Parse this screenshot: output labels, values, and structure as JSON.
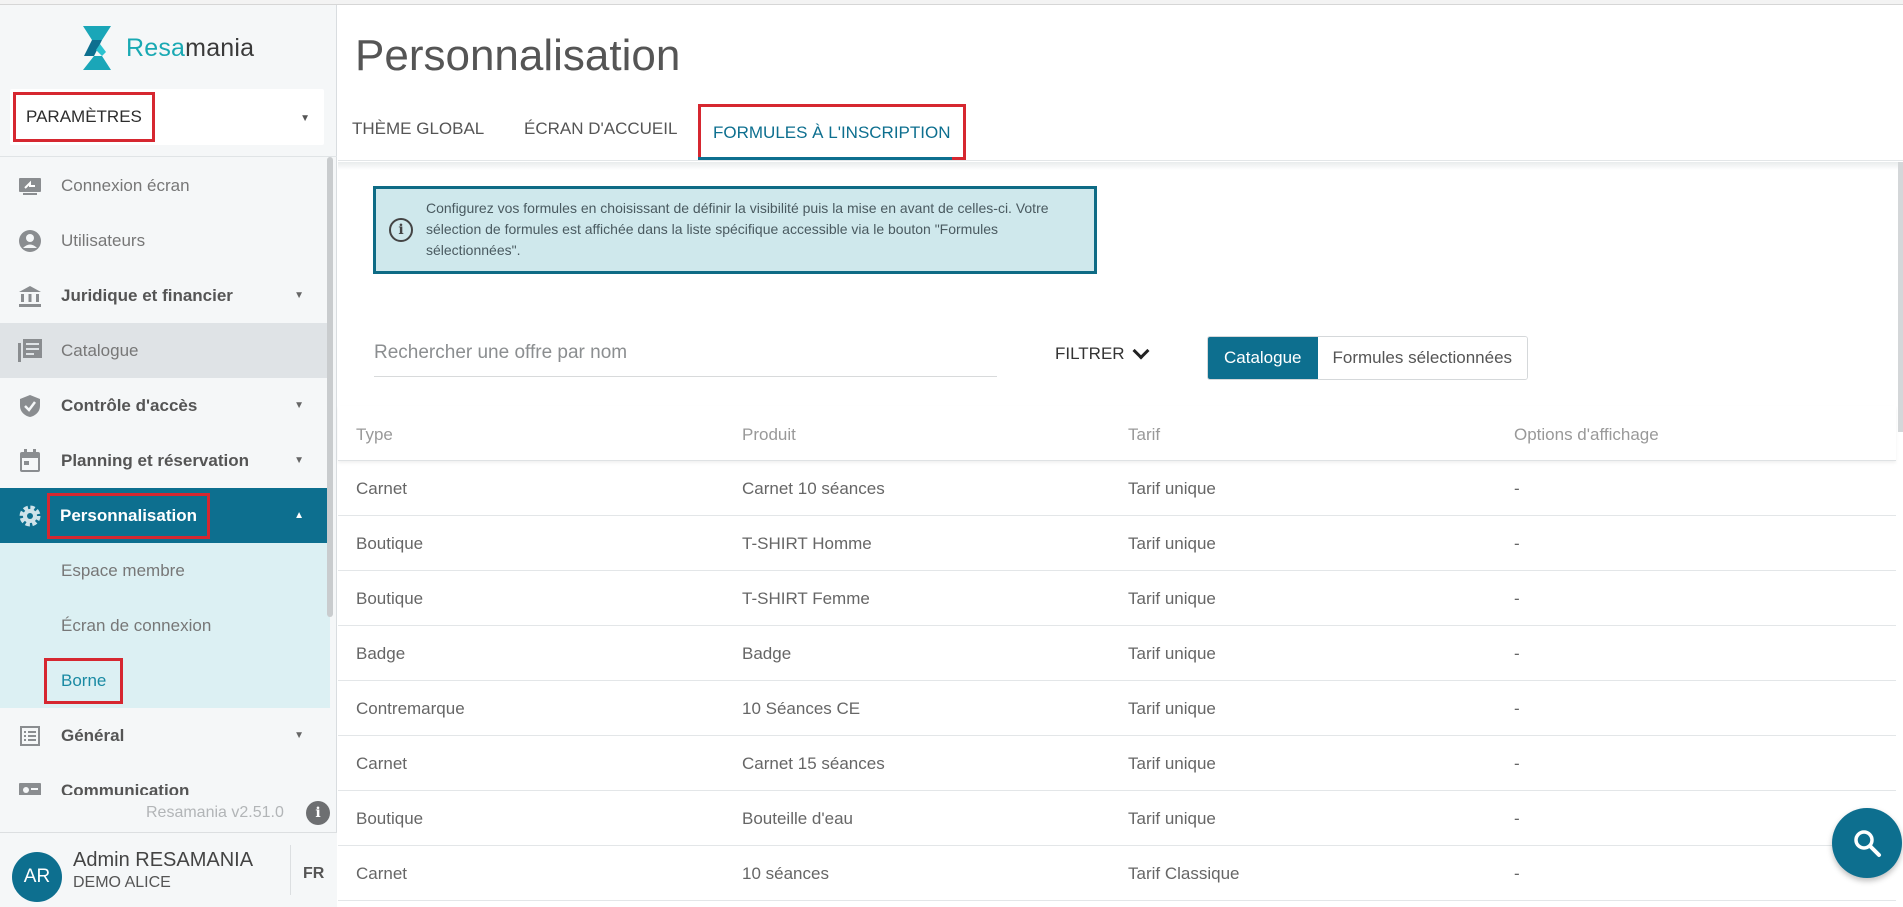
{
  "brand": {
    "part1": "Resa",
    "part2": "mania"
  },
  "module": {
    "label": "PARAMÈTRES"
  },
  "sidebar": {
    "items": [
      {
        "label": "Connexion écran",
        "icon": "screen-share-icon"
      },
      {
        "label": "Utilisateurs",
        "icon": "user-circle-icon"
      },
      {
        "label": "Juridique et financier",
        "icon": "bank-icon"
      },
      {
        "label": "Catalogue",
        "icon": "catalogue-icon"
      },
      {
        "label": "Contrôle d'accès",
        "icon": "shield-check-icon"
      },
      {
        "label": "Planning et réservation",
        "icon": "calendar-icon"
      },
      {
        "label": "Personnalisation",
        "icon": "gear-icon"
      },
      {
        "label": "Espace membre"
      },
      {
        "label": "Écran de connexion"
      },
      {
        "label": "Borne"
      },
      {
        "label": "Général",
        "icon": "list-icon"
      },
      {
        "label": "Communication",
        "icon": "contact-card-icon"
      }
    ],
    "version": "Resamania v2.51.0"
  },
  "user": {
    "initials": "AR",
    "name": "Admin RESAMANIA",
    "org": "DEMO ALICE",
    "lang": "FR"
  },
  "page": {
    "title": "Personnalisation",
    "tabs": [
      {
        "label": "THÈME GLOBAL"
      },
      {
        "label": "ÉCRAN D'ACCUEIL"
      },
      {
        "label": "FORMULES À L'INSCRIPTION"
      }
    ],
    "info": "Configurez vos formules en choisissant de définir la visibilité puis la mise en avant de celles-ci. Votre sélection de formules est affichée dans la liste spécifique accessible via le bouton \"Formules sélectionnées\".",
    "search_placeholder": "Rechercher une offre par nom",
    "filter_label": "FILTRER",
    "segments": [
      "Catalogue",
      "Formules sélectionnées"
    ],
    "table": {
      "headers": [
        "Type",
        "Produit",
        "Tarif",
        "Options d'affichage"
      ],
      "rows": [
        [
          "Carnet",
          "Carnet 10 séances",
          "Tarif unique",
          "-"
        ],
        [
          "Boutique",
          "T-SHIRT Homme",
          "Tarif unique",
          "-"
        ],
        [
          "Boutique",
          "T-SHIRT Femme",
          "Tarif unique",
          "-"
        ],
        [
          "Badge",
          "Badge",
          "Tarif unique",
          "-"
        ],
        [
          "Contremarque",
          "10 Séances CE",
          "Tarif unique",
          "-"
        ],
        [
          "Carnet",
          "Carnet 15 séances",
          "Tarif unique",
          "-"
        ],
        [
          "Boutique",
          "Bouteille d'eau",
          "Tarif unique",
          "-"
        ],
        [
          "Carnet",
          "10 séances",
          "Tarif Classique",
          "-"
        ]
      ]
    }
  },
  "colors": {
    "primary": "#0d6f8f",
    "accent": "#19a9b3",
    "highlight": "#d62730"
  }
}
